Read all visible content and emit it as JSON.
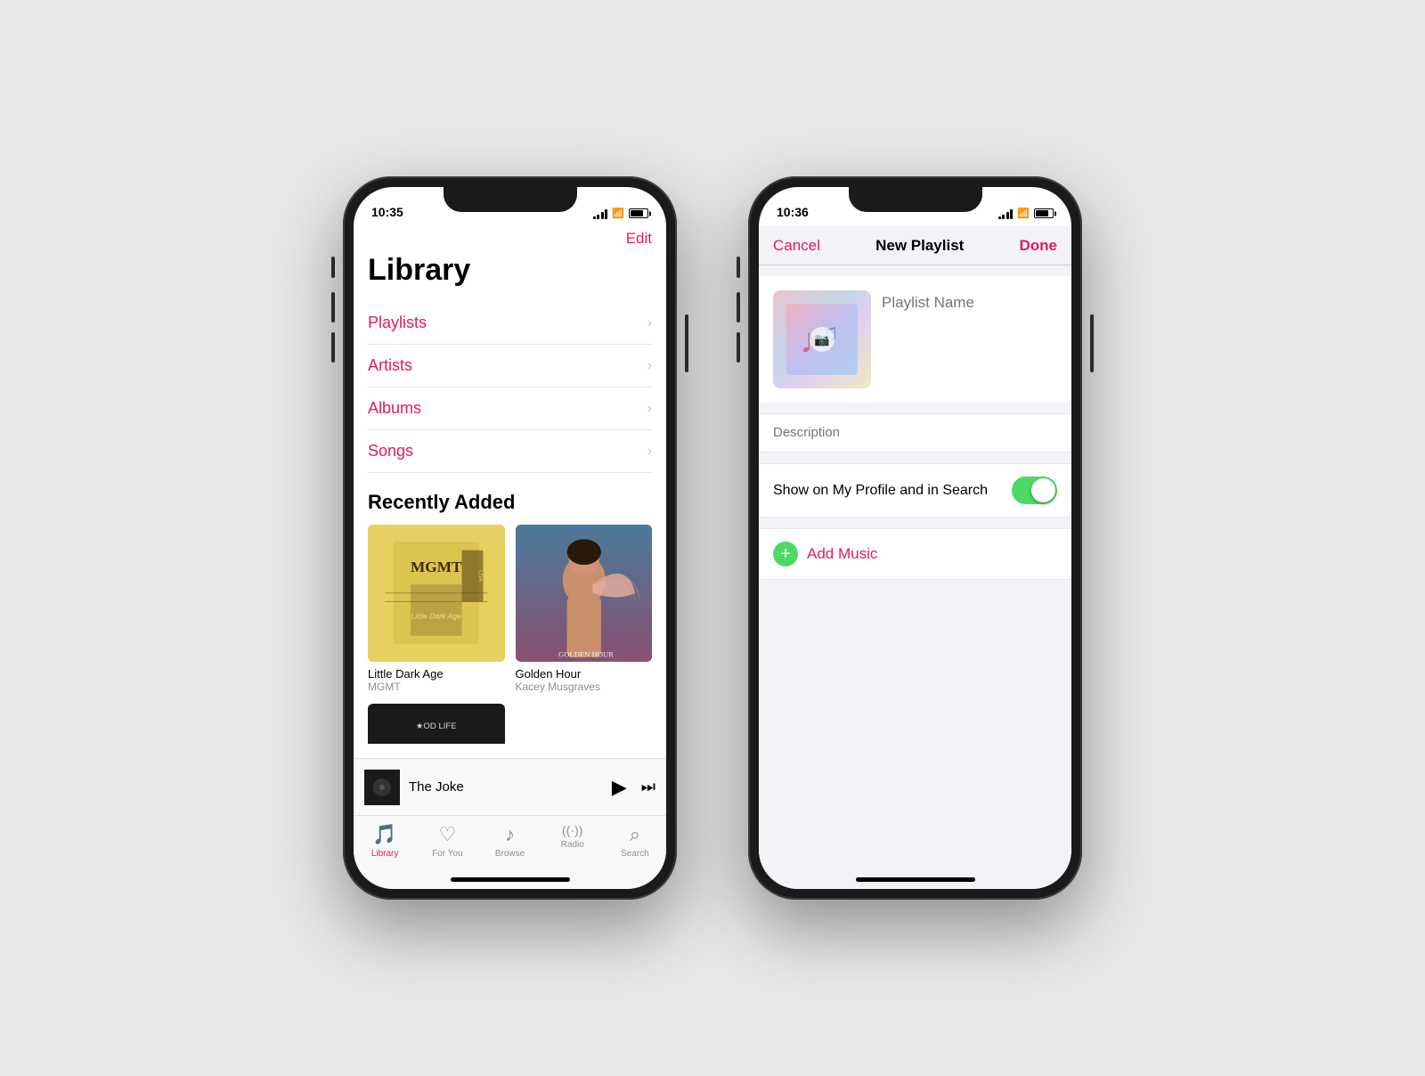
{
  "phone_left": {
    "status": {
      "time": "10:35",
      "location_arrow": "▲"
    },
    "header": {
      "edit_label": "Edit"
    },
    "title": "Library",
    "menu_items": [
      {
        "label": "Playlists"
      },
      {
        "label": "Artists"
      },
      {
        "label": "Albums"
      },
      {
        "label": "Songs"
      }
    ],
    "recently_added_title": "Recently Added",
    "albums": [
      {
        "title": "Little Dark Age",
        "artist": "MGMT"
      },
      {
        "title": "Golden Hour",
        "artist": "Kacey Musgraves"
      }
    ],
    "now_playing": {
      "song": "The Joke"
    },
    "tabs": [
      {
        "label": "Library",
        "active": true
      },
      {
        "label": "For You",
        "active": false
      },
      {
        "label": "Browse",
        "active": false
      },
      {
        "label": "Radio",
        "active": false
      },
      {
        "label": "Search",
        "active": false
      }
    ]
  },
  "phone_right": {
    "status": {
      "time": "10:36"
    },
    "nav": {
      "cancel": "Cancel",
      "title": "New Playlist",
      "done": "Done"
    },
    "playlist_name_placeholder": "Playlist Name",
    "description_placeholder": "Description",
    "toggle": {
      "label": "Show on My Profile and in Search",
      "enabled": true
    },
    "add_music": {
      "label": "Add Music"
    }
  }
}
